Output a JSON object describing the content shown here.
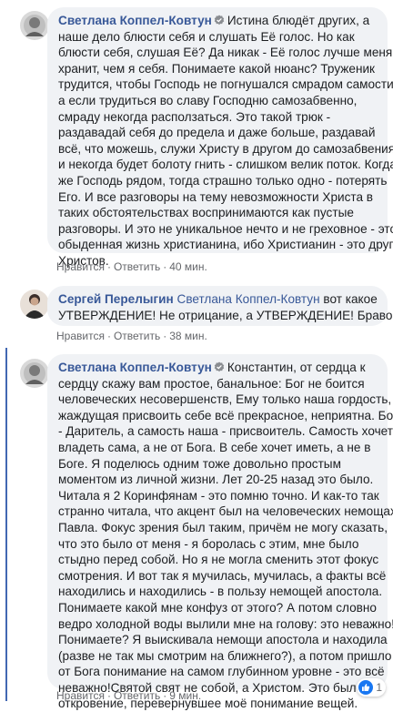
{
  "comments": [
    {
      "author": "Светлана Коппел-Ковтун",
      "verified": true,
      "first_line": "Истина блюдёт других, а",
      "lines": [
        "наше дело блюсти себя и слушать Её голос. Но как",
        "блюсти себя, слушая Её? Да никак - Её голос лучше меня",
        "хранит, чем я себя. Понимаете какой нюанс? Труженик",
        "трудится, чтобы Господь не погнушался смрадом самости,",
        "а если трудиться во славу Господню самозабвенно,",
        "смраду некогда расползаться. Это такой трюк -",
        "раздавадай себя до предела и даже больше, раздавай",
        "всё, что можешь, служи Христу в другом до самозабвения,",
        "и некогда будет болоту гнить - слишком велик поток. Когда",
        "же Господь рядом, тогда страшно только одно - потерять",
        "Его. И все разговоры на тему невозможности Христа в",
        "таких обстоятельствах воспринимаются как пустые",
        "разговоры. И это не уникальное нечто и не греховное - это",
        "обыденная жизнь христианина, ибо Христианин - это друг",
        "Христов."
      ],
      "like": "Нравится",
      "reply": "Ответить",
      "time": "40 мин."
    },
    {
      "author": "Сергей Перелыгин",
      "mention": "Светлана Коппел-Ковтун",
      "first_line": "вот какое",
      "lines": [
        "УТВЕРЖДЕНИЕ! Не отрицание, а УТВЕРЖДЕНИЕ! Браво!"
      ],
      "like": "Нравится",
      "reply": "Ответить",
      "time": "38 мин."
    },
    {
      "author": "Светлана Коппел-Ковтун",
      "verified": true,
      "first_line": "Константин, от сердца к",
      "lines": [
        "сердцу скажу вам простое, банальное: Бог не боится",
        "человеческих несовершенств, Ему только наша гордость,",
        "жаждущая присвоить себе всё прекрасное, неприятна. Бог",
        "- Даритель, а самость наша - присвоитель. Самость хочет",
        "владеть сама, а не от Бога. В себе хочет иметь, а не в",
        "Боге. Я поделюсь одним тоже довольно простым",
        "моментом из личной жизни. Лет 20-25 назад это было.",
        "Читала я 2 Коринфянам - это помню точно. И как-то так",
        "странно читала, что акцент был на человеческих немощах",
        "Павла. Фокус зрения был таким, причём не могу сказать,",
        "что это было от меня - я боролась с этим, мне было",
        "стыдно перед собой. Но я не могла сменить этот фокус",
        "смотрения. И вот так я мучилась, мучилась, а факты всё",
        "находились и находились - в пользу немощей апостола.",
        "Понимаете какой мне конфуз от этого? А потом словно",
        "ведро холодной воды вылили мне на голову: это неважно!",
        "Понимаете? Я выискивала немощи апостола и находила",
        "(разве не так мы смотрим на ближнего?), а потом пришло",
        "от Бога понимание на самом глубинном уровне - это всё",
        "неважно!Святой свят не собой, а Христом. Это было",
        "откровение, перевернувшее моё понимание вещей."
      ],
      "like": "Нравится",
      "reply": "Ответить",
      "time": "9 мин.",
      "reaction_count": "1"
    }
  ],
  "icons": {
    "verified": "verified-badge-icon",
    "like_reaction": "thumbs-up-icon"
  },
  "colors": {
    "author": "#385898",
    "bubble": "#f0f2f5",
    "meta": "#65676b",
    "thread_line": "#4267b2",
    "like_blue": "#1877f2"
  }
}
